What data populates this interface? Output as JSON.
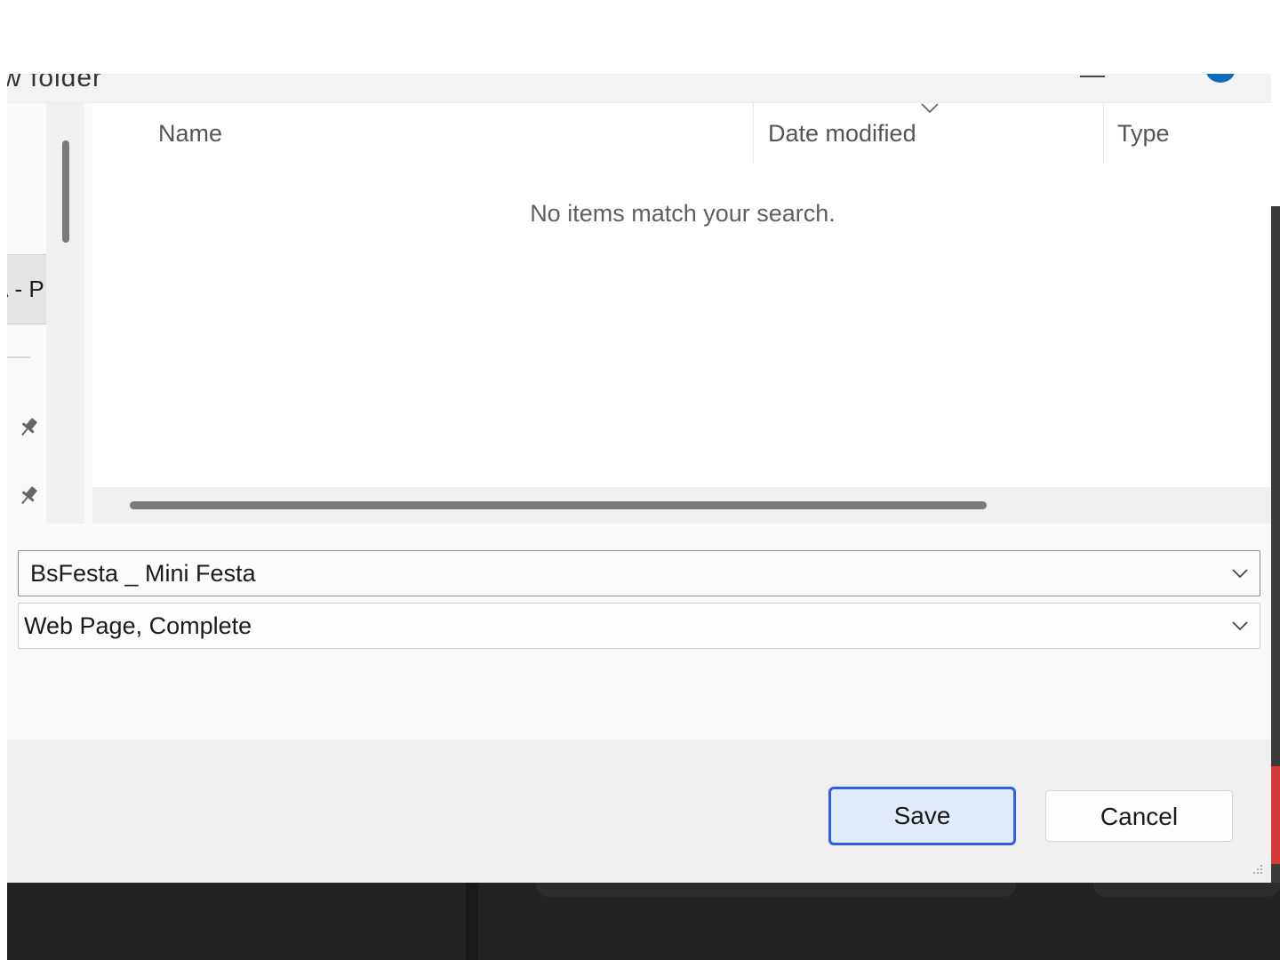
{
  "dialog": {
    "title_fragment": "w folder",
    "nav": {
      "selected_item_fragment": "\\ - P",
      "icons": [
        "pin-icon",
        "pin-icon"
      ]
    },
    "columns": [
      "Name",
      "Date modified",
      "Type"
    ],
    "sort_icon": "chevron-down-icon",
    "empty_message": "No items match your search.",
    "file_name": {
      "value": "BsFesta _ Mini Festa",
      "icon": "chevron-down-icon"
    },
    "save_as_type": {
      "selected": "Web Page, Complete",
      "icon": "chevron-down-icon"
    },
    "buttons": {
      "save": "Save",
      "cancel": "Cancel"
    },
    "accent_color": "#2f5ee8"
  }
}
